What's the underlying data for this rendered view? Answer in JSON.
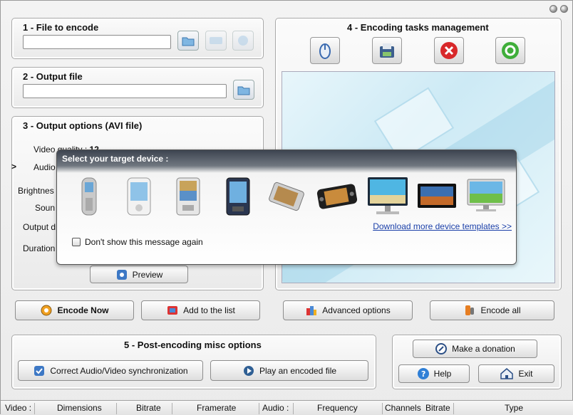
{
  "section1": {
    "title": "1 - File to encode",
    "input_value": ""
  },
  "section2": {
    "title": "2 - Output file",
    "input_value": ""
  },
  "section3": {
    "title": "3 - Output options (AVI file)",
    "video_quality_label": "Video quality :",
    "video_quality_value": "12",
    "audio_label": "Audio",
    "brightness_label": "Brightnes",
    "sound_label": "Soun",
    "output_label": "Output d",
    "duration_label": "Duration",
    "expander": ">",
    "preview_label": "Preview"
  },
  "section4": {
    "title": "4 - Encoding tasks management"
  },
  "actions": {
    "encode_now": "Encode Now",
    "add_to_list": "Add to the list",
    "advanced_options": "Advanced options",
    "encode_all": "Encode all"
  },
  "section5": {
    "title": "5 - Post-encoding misc options",
    "sync_label": "Correct Audio/Video synchronization",
    "play_label": "Play an encoded file"
  },
  "misc": {
    "donation": "Make a donation",
    "help": "Help",
    "exit": "Exit"
  },
  "overlay": {
    "title": "Select your target device :",
    "download_link": "Download more device templates >>",
    "dont_show": "Don't show this message again",
    "devices": [
      "phone-silver",
      "pda-white",
      "pda-photo",
      "pda-dark",
      "portable-player-wide",
      "portable-media-player",
      "widescreen-monitor",
      "lcd-tv",
      "flat-tv"
    ]
  },
  "status": {
    "video": "Video :",
    "dimensions": "Dimensions",
    "bitrate_v": "Bitrate",
    "framerate": "Framerate",
    "audio": "Audio :",
    "frequency": "Frequency",
    "channels": "Channels",
    "bitrate_a": "Bitrate",
    "type": "Type"
  },
  "colors": {
    "link": "#1a3fa8",
    "overlay_header": "#3d4450",
    "film_bg": "#cdeaf5"
  }
}
